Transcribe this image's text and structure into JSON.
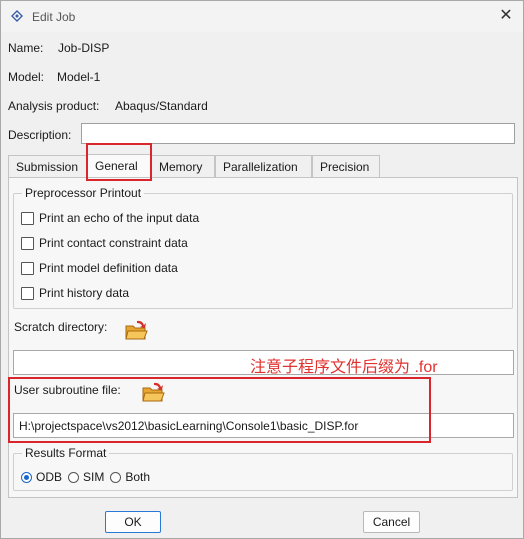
{
  "window": {
    "title": "Edit Job"
  },
  "info": {
    "name_label": "Name:",
    "name_value": "Job-DISP",
    "model_label": "Model:",
    "model_value": "Model-1",
    "product_label": "Analysis product:",
    "product_value": "Abaqus/Standard",
    "description_label": "Description:",
    "description_value": ""
  },
  "tabs": [
    {
      "label": "Submission"
    },
    {
      "label": "General"
    },
    {
      "label": "Memory"
    },
    {
      "label": "Parallelization"
    },
    {
      "label": "Precision"
    }
  ],
  "active_tab": "General",
  "preprocessor": {
    "title": "Preprocessor Printout",
    "options": [
      {
        "label": "Print an echo of the input data",
        "checked": false
      },
      {
        "label": "Print contact constraint data",
        "checked": false
      },
      {
        "label": "Print model definition data",
        "checked": false
      },
      {
        "label": "Print history data",
        "checked": false
      }
    ]
  },
  "scratch": {
    "label": "Scratch directory:",
    "value": ""
  },
  "annotation": "注意子程序文件后缀为 .for",
  "subroutine": {
    "label": "User subroutine file:",
    "value": "H:\\projectspace\\vs2012\\basicLearning\\Console1\\basic_DISP.for"
  },
  "results": {
    "title": "Results Format",
    "options": [
      {
        "label": "ODB",
        "selected": true
      },
      {
        "label": "SIM",
        "selected": false
      },
      {
        "label": "Both",
        "selected": false
      }
    ]
  },
  "buttons": {
    "ok": "OK",
    "cancel": "Cancel"
  },
  "colors": {
    "highlight": "#d9262c",
    "accent": "#1a66cc"
  }
}
